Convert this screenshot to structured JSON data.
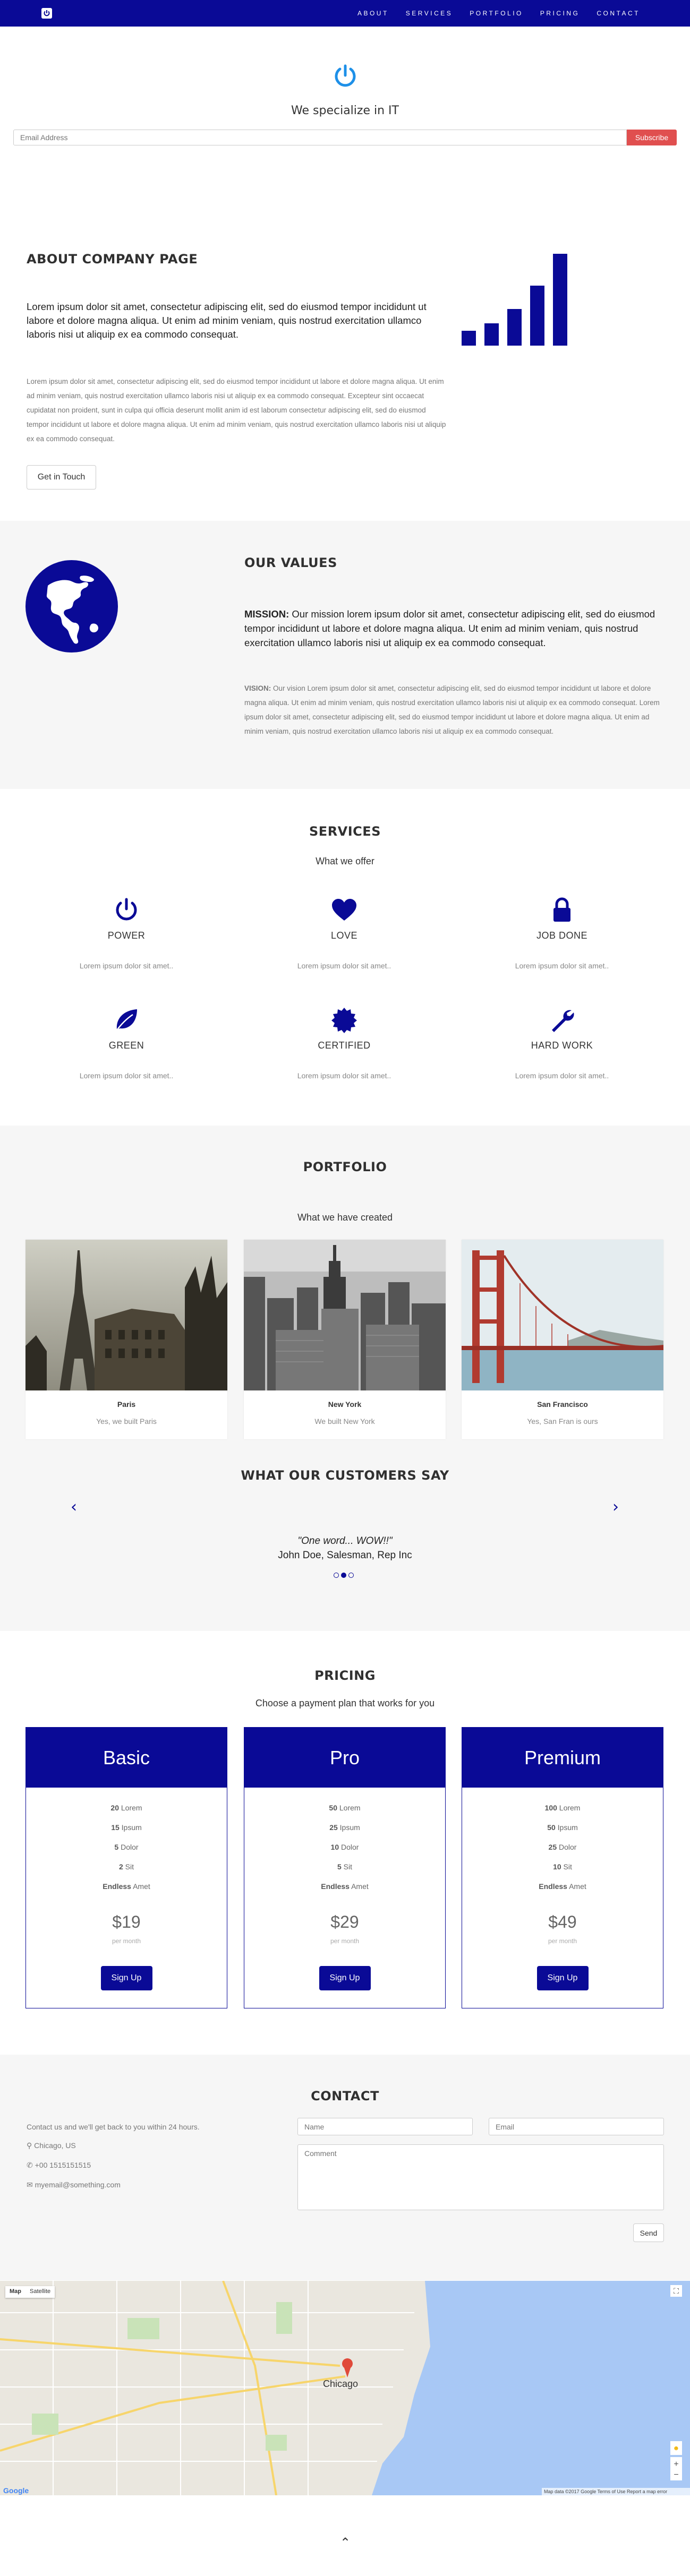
{
  "nav": {
    "links": [
      "ABOUT",
      "SERVICES",
      "PORTFOLIO",
      "PRICING",
      "CONTACT"
    ]
  },
  "hero": {
    "title": "We specialize in IT",
    "email_placeholder": "Email Address",
    "subscribe_label": "Subscribe"
  },
  "about": {
    "title": "ABOUT COMPANY PAGE",
    "lead": "Lorem ipsum dolor sit amet, consectetur adipiscing elit, sed do eiusmod tempor incididunt ut labore et dolore magna aliqua. Ut enim ad minim veniam, quis nostrud exercitation ullamco laboris nisi ut aliquip ex ea commodo consequat.",
    "body": "Lorem ipsum dolor sit amet, consectetur adipiscing elit, sed do eiusmod tempor incididunt ut labore et dolore magna aliqua. Ut enim ad minim veniam, quis nostrud exercitation ullamco laboris nisi ut aliquip ex ea commodo consequat. Excepteur sint occaecat cupidatat non proident, sunt in culpa qui officia deserunt mollit anim id est laborum consectetur adipiscing elit, sed do eiusmod tempor incididunt ut labore et dolore magna aliqua. Ut enim ad minim veniam, quis nostrud exercitation ullamco laboris nisi ut aliquip ex ea commodo consequat.",
    "button_label": "Get in Touch"
  },
  "values": {
    "title": "OUR VALUES",
    "mission_label": "MISSION:",
    "mission_text": " Our mission lorem ipsum dolor sit amet, consectetur adipiscing elit, sed do eiusmod tempor incididunt ut labore et dolore magna aliqua. Ut enim ad minim veniam, quis nostrud exercitation ullamco laboris nisi ut aliquip ex ea commodo consequat.",
    "vision_label": "VISION:",
    "vision_text": " Our vision Lorem ipsum dolor sit amet, consectetur adipiscing elit, sed do eiusmod tempor incididunt ut labore et dolore magna aliqua. Ut enim ad minim veniam, quis nostrud exercitation ullamco laboris nisi ut aliquip ex ea commodo consequat. Lorem ipsum dolor sit amet, consectetur adipiscing elit, sed do eiusmod tempor incididunt ut labore et dolore magna aliqua. Ut enim ad minim veniam, quis nostrud exercitation ullamco laboris nisi ut aliquip ex ea commodo consequat."
  },
  "services": {
    "title": "SERVICES",
    "subtitle": "What we offer",
    "items": [
      {
        "name": "POWER",
        "desc": "Lorem ipsum dolor sit amet..",
        "icon": "power-icon"
      },
      {
        "name": "LOVE",
        "desc": "Lorem ipsum dolor sit amet..",
        "icon": "heart-icon"
      },
      {
        "name": "JOB DONE",
        "desc": "Lorem ipsum dolor sit amet..",
        "icon": "lock-icon"
      },
      {
        "name": "GREEN",
        "desc": "Lorem ipsum dolor sit amet..",
        "icon": "leaf-icon"
      },
      {
        "name": "CERTIFIED",
        "desc": "Lorem ipsum dolor sit amet..",
        "icon": "certificate-icon"
      },
      {
        "name": "HARD WORK",
        "desc": "Lorem ipsum dolor sit amet..",
        "icon": "wrench-icon"
      }
    ]
  },
  "portfolio": {
    "title": "PORTFOLIO",
    "subtitle": "What we have created",
    "items": [
      {
        "name": "Paris",
        "desc": "Yes, we built Paris"
      },
      {
        "name": "New York",
        "desc": "We built New York"
      },
      {
        "name": "San Francisco",
        "desc": "Yes, San Fran is ours"
      }
    ]
  },
  "testimonials": {
    "title": "WHAT OUR CUSTOMERS SAY",
    "quote": "\"One word... WOW!!\"",
    "author": "John Doe, Salesman, Rep Inc",
    "active_index": 1,
    "count": 3
  },
  "pricing": {
    "title": "PRICING",
    "subtitle": "Choose a payment plan that works for you",
    "plans": [
      {
        "name": "Basic",
        "features": [
          [
            "20",
            " Lorem"
          ],
          [
            "15",
            " Ipsum"
          ],
          [
            "5",
            " Dolor"
          ],
          [
            "2",
            " Sit"
          ],
          [
            "Endless",
            " Amet"
          ]
        ],
        "price": "$19",
        "period": "per month",
        "button": "Sign Up"
      },
      {
        "name": "Pro",
        "features": [
          [
            "50",
            " Lorem"
          ],
          [
            "25",
            " Ipsum"
          ],
          [
            "10",
            " Dolor"
          ],
          [
            "5",
            " Sit"
          ],
          [
            "Endless",
            " Amet"
          ]
        ],
        "price": "$29",
        "period": "per month",
        "button": "Sign Up"
      },
      {
        "name": "Premium",
        "features": [
          [
            "100",
            " Lorem"
          ],
          [
            "50",
            " Ipsum"
          ],
          [
            "25",
            " Dolor"
          ],
          [
            "10",
            " Sit"
          ],
          [
            "Endless",
            " Amet"
          ]
        ],
        "price": "$49",
        "period": "per month",
        "button": "Sign Up"
      }
    ]
  },
  "contact": {
    "title": "CONTACT",
    "intro": "Contact us and we'll get back to you within 24 hours.",
    "location": "Chicago, US",
    "phone": "+00 1515151515",
    "email": "myemail@something.com",
    "name_placeholder": "Name",
    "email_placeholder": "Email",
    "comment_placeholder": "Comment",
    "send_label": "Send"
  },
  "map": {
    "type_map": "Map",
    "type_satellite": "Satellite",
    "city_label": "Chicago",
    "attribution": "Map data ©2017 Google  Terms of Use  Report a map error"
  },
  "colors": {
    "brand": "#0a0a96",
    "accent": "#e04f4f"
  }
}
